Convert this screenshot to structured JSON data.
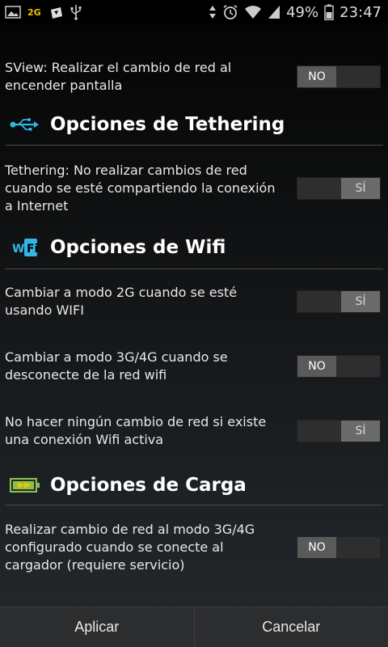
{
  "statusbar": {
    "left_icons": [
      "image-icon",
      "2g-icon",
      "shopping-bag-icon",
      "usb-icon"
    ],
    "network_label": "2G",
    "battery_percent": "49%",
    "time": "23:47"
  },
  "settings": [
    {
      "label": "SView: Realizar el cambio de red al encender pantalla",
      "value": "NO",
      "on": false
    },
    {
      "label": "Tethering: No realizar cambios de red cuando se esté compartiendo la conexión a Internet",
      "value": "SÍ",
      "on": true
    },
    {
      "label": "Cambiar a modo 2G cuando se esté usando WIFI",
      "value": "SÍ",
      "on": true
    },
    {
      "label": "Cambiar a modo 3G/4G cuando se desconecte de la red wifi",
      "value": "NO",
      "on": false
    },
    {
      "label": "No hacer ningún cambio de red si existe una conexión Wifi activa",
      "value": "SÍ",
      "on": true
    },
    {
      "label": "Realizar cambio de red al modo 3G/4G configurado cuando se conecte al cargador (requiere servicio)",
      "value": "NO",
      "on": false
    }
  ],
  "sections": {
    "tethering": {
      "title": "Opciones de Tethering",
      "icon": "usb-icon"
    },
    "wifi": {
      "title": "Opciones de Wifi",
      "icon": "wifi-icon"
    },
    "carga": {
      "title": "Opciones de Carga",
      "icon": "battery-charging-icon"
    }
  },
  "buttons": {
    "apply": "Aplicar",
    "cancel": "Cancelar"
  },
  "colors": {
    "background": "#000000",
    "accent_usb": "#33b5e5",
    "battery_green": "#8bc34a",
    "battery_yellow": "#f5c400"
  }
}
